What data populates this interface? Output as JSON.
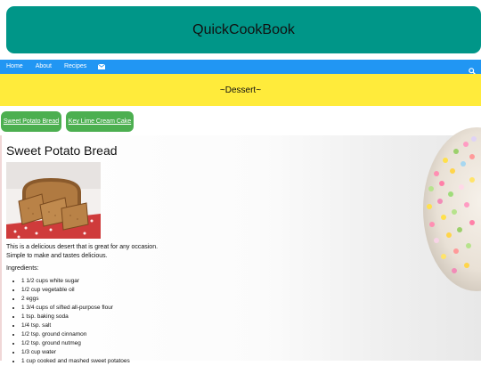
{
  "header": {
    "title": "QuickCookBook"
  },
  "nav": {
    "items": [
      "Home",
      "About",
      "Recipes"
    ],
    "mail_icon": "envelope-icon",
    "search_icon": "search-icon"
  },
  "category": {
    "title": "~Dessert~"
  },
  "recipe_buttons": [
    "Sweet Potato Bread",
    "Key Lime Cream Cake"
  ],
  "recipe": {
    "title": "Sweet Potato Bread",
    "description_line1": "This is a delicious desert that is great for any occasion.",
    "description_line2": "Simple to make and tastes delicious.",
    "ingredients_heading": "Ingredients:",
    "ingredients": [
      "1 1/2 cups white sugar",
      "1/2 cup vegetable oil",
      "2 eggs",
      "1 3/4 cups of sifted all-purpose flour",
      "1 tsp. baking soda",
      "1/4 tsp. salt",
      "1/2 tsp. ground cinnamon",
      "1/2 tsp. ground nutmeg",
      "1/3 cup water",
      "1 cup cooked and mashed sweet potatoes"
    ]
  },
  "colors": {
    "title_bg": "#009688",
    "nav_bg": "#2196f3",
    "category_bg": "#ffeb3b",
    "button_bg": "#4caf50"
  }
}
